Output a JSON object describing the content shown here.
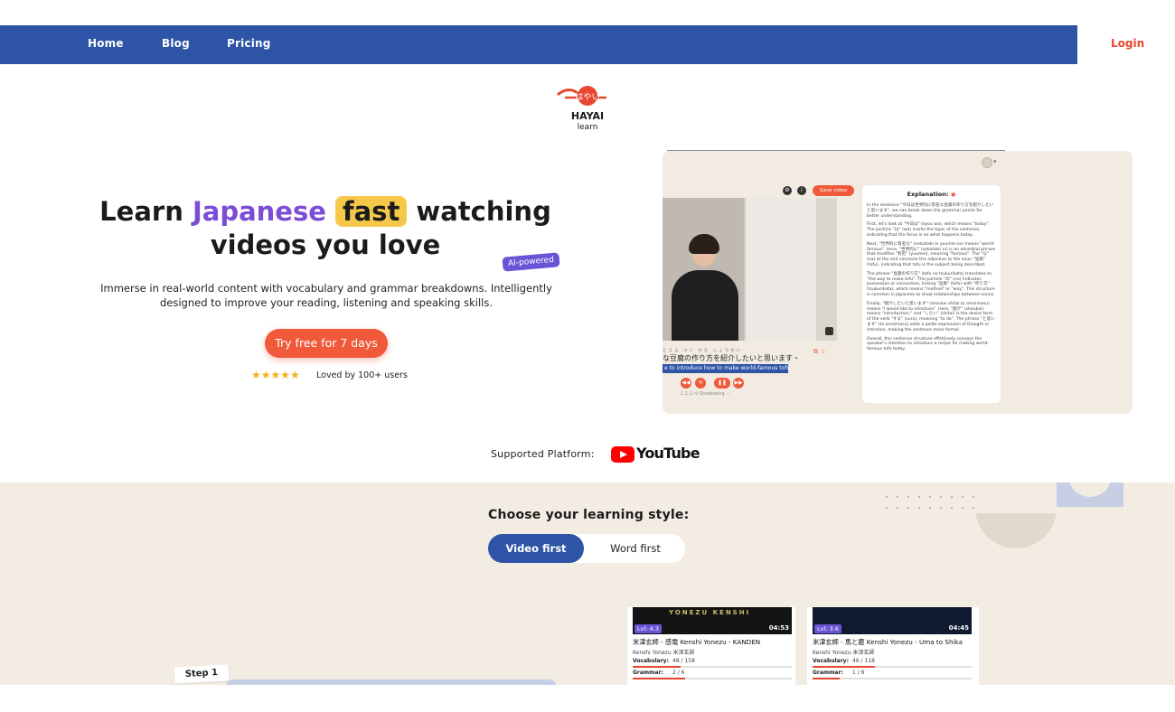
{
  "nav": {
    "links": [
      "Home",
      "Blog",
      "Pricing"
    ],
    "login": "Login",
    "bg_color": "#2d54a6"
  },
  "logo": {
    "name": "HAYAI",
    "sub": "learn",
    "mark": "はやい"
  },
  "hero": {
    "title_learn": "Learn",
    "title_japanese": "Japanese",
    "title_fast": "fast",
    "title_watching": "watching",
    "title_line2": "videos you love",
    "badge": "AI-powered",
    "subtitle": "Immerse in real-world content with vocabulary and grammar breakdowns. Intelligently designed to improve your reading, listening and speaking skills.",
    "cta": "Try free for 7 days",
    "stars": "★★★★★",
    "rating": 5,
    "loved": "Loved by 100+ users"
  },
  "preview": {
    "save_video": "Save video",
    "subtitle_furigana": "とうふ つく かた しょうかい",
    "subtitle_text": "な豆腐の作り方を紹介したいと思います・",
    "translation": "e to introduce how to make world-famous tofu.",
    "player_labels": "1.1  ⊡  ⟲  Shadowing  ⋯",
    "explanation_title": "Explanation:",
    "explanation": [
      "In the sentence \"今日は世界的に有名な豆腐の作り方を紹介したいと思います\", we can break down the grammar points for better understanding.",
      "First, let's look at \"今日は\" (kyou wa), which means \"today\". The particle \"は\" (wa) marks the topic of the sentence, indicating that the focus is on what happens today.",
      "Next, \"世界的に有名な\" (sekaiteki ni yuumei na) means \"world-famous\". Here, \"世界的に\" (sekaiteki ni) is an adverbial phrase that modifies \"有名\" (yuumei), meaning \"famous\". The \"な\" (na) at the end connects the adjective to the noun \"豆腐\" (tofu), indicating that tofu is the subject being described.",
      "The phrase \"豆腐の作り方\" (tofu no tsukurikata) translates to \"the way to make tofu\". The particle \"の\" (no) indicates possession or connection, linking \"豆腐\" (tofu) with \"作り方\" (tsukurikata), which means \"method\" or \"way\". This structure is common in Japanese to show relationships between nouns.",
      "Finally, \"紹介したいと思います\" (shoukai shitai to omoimasu) means \"I would like to introduce\". Here, \"紹介\" (shoukai) means \"introduction,\" and \"したい\" (shitai) is the desire form of the verb \"する\" (suru), meaning \"to do\". The phrase \"と思います\" (to omoimasu) adds a polite expression of thought or intention, making the sentence more formal.",
      "Overall, this sentence structure effectively conveys the speaker's intention to introduce a recipe for making world-famous tofu today."
    ]
  },
  "platform": {
    "label": "Supported Platform:",
    "name": "YouTube"
  },
  "learning": {
    "title": "Choose your learning style:",
    "active": "Video first",
    "inactive": "Word first",
    "step": "Step 1"
  },
  "videos": [
    {
      "thumb_text": "YONEZU KENSHI",
      "level": "Lvl: 4.3",
      "duration": "04:53",
      "title": "米津玄師 - 感電 Kenshi Yonezu - KANDEN",
      "artist": "Kenshi Yonezu 米津玄師",
      "vocab_label": "Vocabulary:",
      "vocab": "48 / 158",
      "vocab_frac": 0.3,
      "grammar_label": "Grammar:",
      "grammar": "2 / 6",
      "grammar_frac": 0.33
    },
    {
      "thumb_text": "",
      "level": "Lvl: 3.6",
      "duration": "04:45",
      "title": "米津玄師 - 馬と鹿 Kenshi Yonezu - Uma to Shika",
      "artist": "Kenshi Yonezu 米津玄師",
      "vocab_label": "Vocabulary:",
      "vocab": "46 / 118",
      "vocab_frac": 0.39,
      "grammar_label": "Grammar:",
      "grammar": "1 / 6",
      "grammar_frac": 0.17
    }
  ]
}
